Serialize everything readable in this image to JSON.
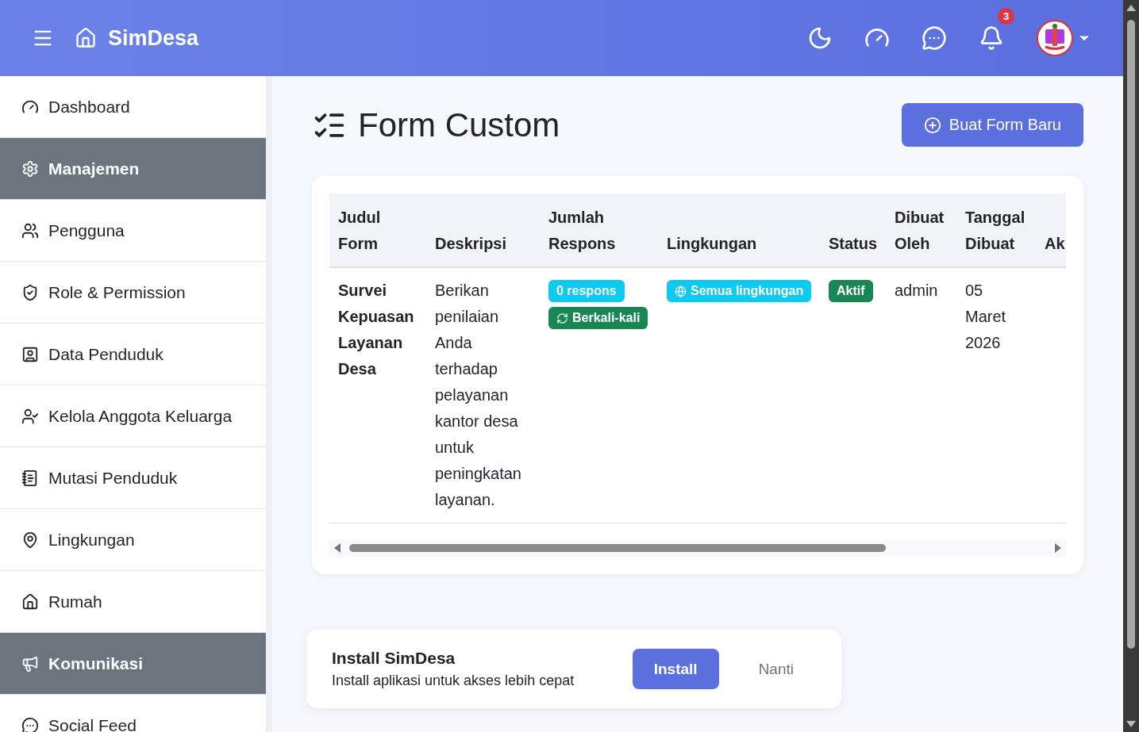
{
  "navbar": {
    "brand": "SimDesa",
    "notification_count": "3"
  },
  "sidebar": {
    "items": [
      {
        "kind": "link",
        "label": "Dashboard"
      },
      {
        "kind": "section",
        "label": "Manajemen"
      },
      {
        "kind": "link",
        "label": "Pengguna"
      },
      {
        "kind": "link",
        "label": "Role & Permission"
      },
      {
        "kind": "link",
        "label": "Data Penduduk"
      },
      {
        "kind": "link",
        "label": "Kelola Anggota Keluarga"
      },
      {
        "kind": "link",
        "label": "Mutasi Penduduk"
      },
      {
        "kind": "link",
        "label": "Lingkungan"
      },
      {
        "kind": "link",
        "label": "Rumah"
      },
      {
        "kind": "section",
        "label": "Komunikasi"
      },
      {
        "kind": "link",
        "label": "Social Feed"
      }
    ]
  },
  "page": {
    "title": "Form Custom",
    "new_button": "Buat Form Baru"
  },
  "table": {
    "columns": [
      "Judul Form",
      "Deskripsi",
      "Jumlah Respons",
      "Lingkungan",
      "Status",
      "Dibuat Oleh",
      "Tanggal Dibuat",
      "Ak"
    ],
    "rows": [
      {
        "title": "Survei Kepuasan Layanan Desa",
        "description": "Berikan penilaian Anda terhadap pelayanan kantor desa untuk peningkatan layanan.",
        "responses": [
          {
            "kind": "count",
            "label": "0 respons",
            "color": "#0dcaf0"
          },
          {
            "kind": "repeat",
            "label": "Berkali-kali",
            "color": "#198754"
          }
        ],
        "scope": {
          "label": "Semua lingkungan",
          "color": "#0dcaf0"
        },
        "status": {
          "label": "Aktif",
          "color": "#198754"
        },
        "created_by": "admin",
        "created_at": "05 Maret 2026"
      }
    ]
  },
  "install_prompt": {
    "title": "Install SimDesa",
    "text": "Install aplikasi untuk akses lebih cepat",
    "install_button": "Install",
    "later_button": "Nanti"
  }
}
